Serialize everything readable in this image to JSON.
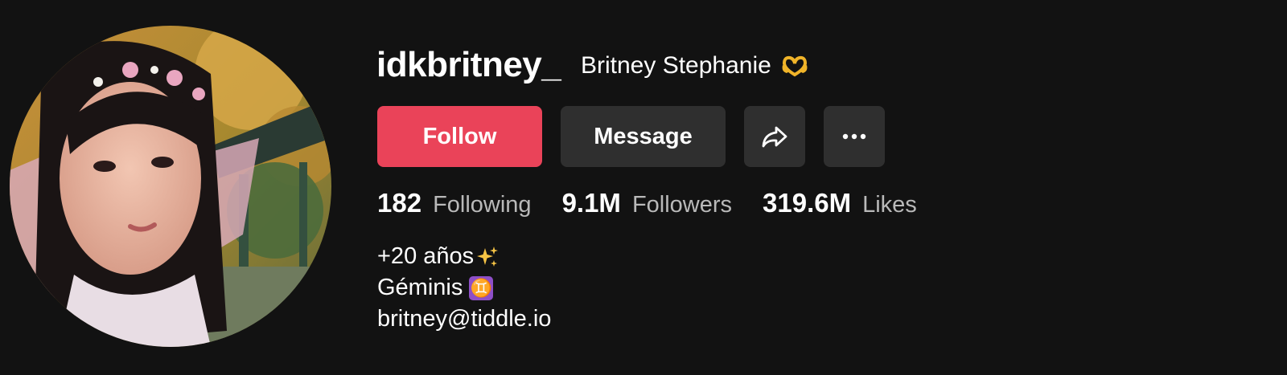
{
  "profile": {
    "username": "idkbritney_",
    "display_name": "Britney Stephanie",
    "display_name_emoji": "heart-hands-icon",
    "avatar_icon": "profile-photo"
  },
  "actions": {
    "follow_label": "Follow",
    "message_label": "Message",
    "share_icon": "share-icon",
    "more_icon": "more-icon"
  },
  "stats": [
    {
      "value": "182",
      "label": "Following"
    },
    {
      "value": "9.1M",
      "label": "Followers"
    },
    {
      "value": "319.6M",
      "label": "Likes"
    }
  ],
  "bio": {
    "line1": "+20 años",
    "line1_emoji": "sparkles-icon",
    "line2": "Géminis",
    "line2_emoji": "gemini-icon",
    "line2_glyph": "♊",
    "line3": "britney@tiddle.io"
  },
  "colors": {
    "background": "#121212",
    "follow_button": "#ea4359",
    "secondary_button": "#2f2f2f",
    "stat_label": "#b9b9b9"
  }
}
